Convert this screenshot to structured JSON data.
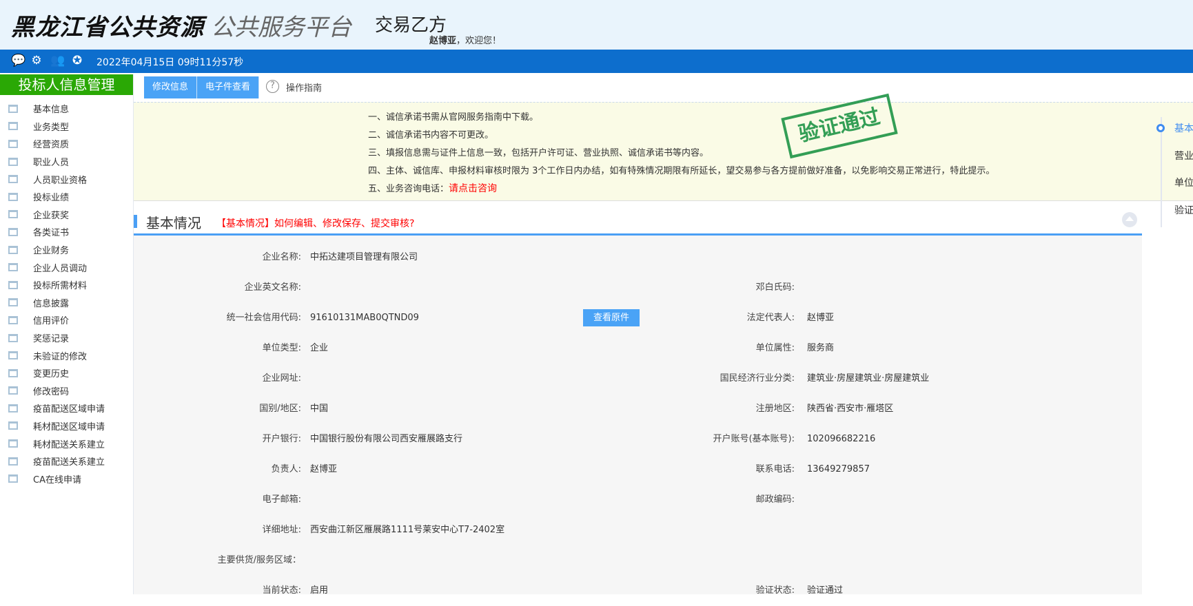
{
  "header": {
    "logo_bold": "黑龙江省公共资源",
    "logo_light": "公共服务平台",
    "role": "交易乙方",
    "user": "赵博亚",
    "welcome": "，欢迎您！"
  },
  "topbar": {
    "icons": [
      "chat-icon",
      "gear-icon",
      "users-icon",
      "globe-icon"
    ],
    "datetime": "2022年04月15日 09时11分57秒",
    "color": "#0d6ecd"
  },
  "sidebar": {
    "title": "投标人信息管理",
    "items": [
      "基本信息",
      "业务类型",
      "经营资质",
      "职业人员",
      "人员职业资格",
      "投标业绩",
      "企业获奖",
      "各类证书",
      "企业财务",
      "企业人员调动",
      "投标所需材料",
      "信息披露",
      "信用评价",
      "奖惩记录",
      "未验证的修改",
      "变更历史",
      "修改密码",
      "疫苗配送区域申请",
      "耗材配送区域申请",
      "耗材配送关系建立",
      "疫苗配送关系建立",
      "CA在线申请"
    ]
  },
  "toolbar": {
    "edit": "修改信息",
    "view_docs": "电子件查看",
    "guide": "操作指南"
  },
  "notice": {
    "lines": [
      "一、诚信承诺书需从官网服务指南中下载。",
      "二、诚信承诺书内容不可更改。",
      "三、填报信息需与证件上信息一致，包括开户许可证、营业执照、诚信承诺书等内容。",
      "四、主体、诚信库、申报材料审核时限为 3个工作日内办结，如有特殊情况期限有所延长，望交易参与各方提前做好准备，以免影响交易正常进行，特此提示。"
    ],
    "consult_prefix": "五、业务咨询电话：",
    "consult_link": "请点击咨询",
    "stamp": "验证通过"
  },
  "section": {
    "title": "基本情况",
    "help_link": "【基本情况】如何编辑、修改保存、提交审核?"
  },
  "form": {
    "view_original": "查看原件",
    "rows": [
      {
        "l1": "企业名称:",
        "v1": "中拓达建项目管理有限公司",
        "l2": "",
        "v2": ""
      },
      {
        "l1": "企业英文名称:",
        "v1": "",
        "l2": "邓白氏码:",
        "v2": ""
      },
      {
        "l1": "统一社会信用代码:",
        "v1": "91610131MAB0QTND09",
        "l2": "法定代表人:",
        "v2": "赵博亚"
      },
      {
        "l1": "单位类型:",
        "v1": "企业",
        "l2": "单位属性:",
        "v2": "服务商"
      },
      {
        "l1": "企业网址:",
        "v1": "",
        "l2": "国民经济行业分类:",
        "v2": "建筑业·房屋建筑业·房屋建筑业"
      },
      {
        "l1": "国别/地区:",
        "v1": "中国",
        "l2": "注册地区:",
        "v2": "陕西省·西安市·雁塔区"
      },
      {
        "l1": "开户银行:",
        "v1": "中国银行股份有限公司西安雁展路支行",
        "l2": "开户账号(基本账号):",
        "v2": "102096682216"
      },
      {
        "l1": "负责人:",
        "v1": "赵博亚",
        "l2": "联系电话:",
        "v2": "13649279857"
      },
      {
        "l1": "电子邮箱:",
        "v1": "",
        "l2": "邮政编码:",
        "v2": ""
      },
      {
        "l1": "详细地址:",
        "v1": "西安曲江新区雁展路1111号莱安中心T7-2402室",
        "l2": "",
        "v2": ""
      },
      {
        "l1": "主要供货/服务区域：",
        "v1": "",
        "l2": "",
        "v2": ""
      },
      {
        "l1": "当前状态:",
        "v1": "启用",
        "l2": "验证状态:",
        "v2": "验证通过"
      }
    ]
  },
  "right_nav": {
    "items": [
      "基本",
      "营业",
      "单位",
      "验证"
    ],
    "active": 0
  }
}
